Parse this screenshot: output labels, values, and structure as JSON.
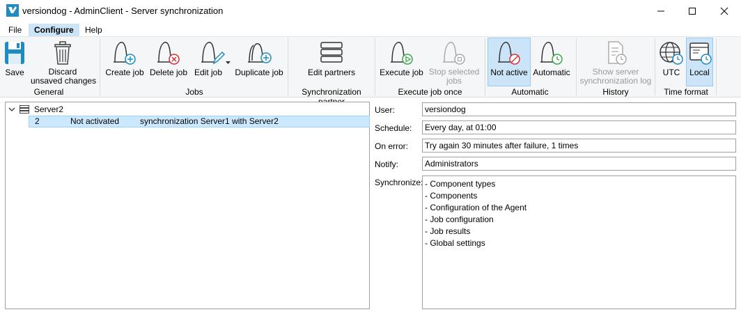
{
  "window": {
    "title": "versiondog - AdminClient - Server synchronization"
  },
  "menu": {
    "file": "File",
    "configure": "Configure",
    "help": "Help"
  },
  "ribbon": {
    "general": {
      "label": "General",
      "save": "Save",
      "discard_line1": "Discard",
      "discard_line2": "unsaved changes"
    },
    "jobs": {
      "label": "Jobs",
      "create": "Create job",
      "delete": "Delete job",
      "edit": "Edit job",
      "duplicate": "Duplicate job"
    },
    "partner": {
      "label": "Synchronization partner",
      "edit_partners": "Edit partners"
    },
    "execute": {
      "label": "Execute job once",
      "execute": "Execute job",
      "stop_line1": "Stop selected",
      "stop_line2": "jobs"
    },
    "automatic": {
      "label": "Automatic",
      "not_active": "Not active",
      "automatic": "Automatic"
    },
    "history": {
      "label": "History",
      "show_line1": "Show server",
      "show_line2": "synchronization log"
    },
    "time_format": {
      "label": "Time format",
      "utc": "UTC",
      "local": "Local"
    }
  },
  "tree": {
    "server": "Server2",
    "jobs": [
      {
        "id": "2",
        "status": "Not activated",
        "description": "synchronization Server1 with Server2"
      }
    ]
  },
  "details": {
    "user_label": "User:",
    "user": "versiondog",
    "schedule_label": "Schedule:",
    "schedule": "Every day, at 01:00",
    "on_error_label": "On error:",
    "on_error": "Try again 30 minutes after failure, 1 times",
    "notify_label": "Notify:",
    "notify": "Administrators",
    "synchronize_label": "Synchronize:",
    "synchronize": [
      "- Component types",
      "- Components",
      "- Configuration of the Agent",
      "- Job configuration",
      "- Job results",
      "- Global settings"
    ]
  },
  "colors": {
    "accent_blue": "#1e8bc3",
    "selection": "#cce8ff",
    "active_button": "#cce4f7",
    "delete_red": "#d13438",
    "execute_green": "#3aa64a"
  }
}
